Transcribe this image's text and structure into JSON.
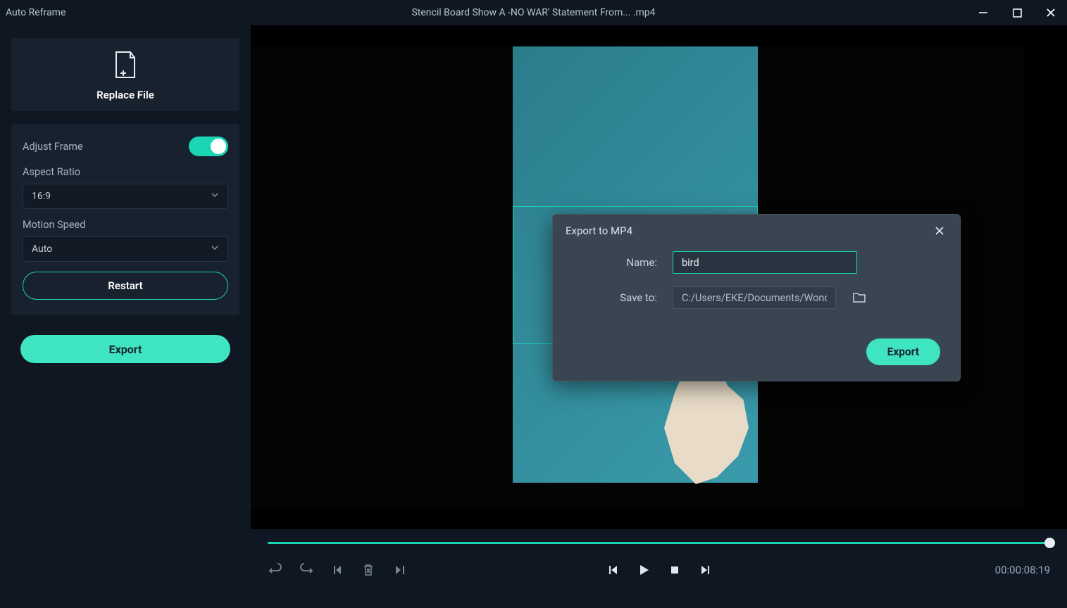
{
  "titlebar": {
    "app_name": "Auto Reframe",
    "file_name": "Stencil Board Show A -NO WAR' Statement From... .mp4"
  },
  "sidebar": {
    "replace_file_label": "Replace File",
    "adjust_frame_label": "Adjust Frame",
    "adjust_frame_on": true,
    "aspect_ratio_label": "Aspect Ratio",
    "aspect_ratio_value": "16:9",
    "motion_speed_label": "Motion Speed",
    "motion_speed_value": "Auto",
    "restart_label": "Restart",
    "export_label": "Export"
  },
  "timeline": {
    "timecode": "00:00:08:19"
  },
  "modal": {
    "title": "Export to MP4",
    "name_label": "Name:",
    "name_value": "bird",
    "save_to_label": "Save to:",
    "save_to_value": "C:/Users/EKE/Documents/Wonde",
    "export_label": "Export"
  }
}
